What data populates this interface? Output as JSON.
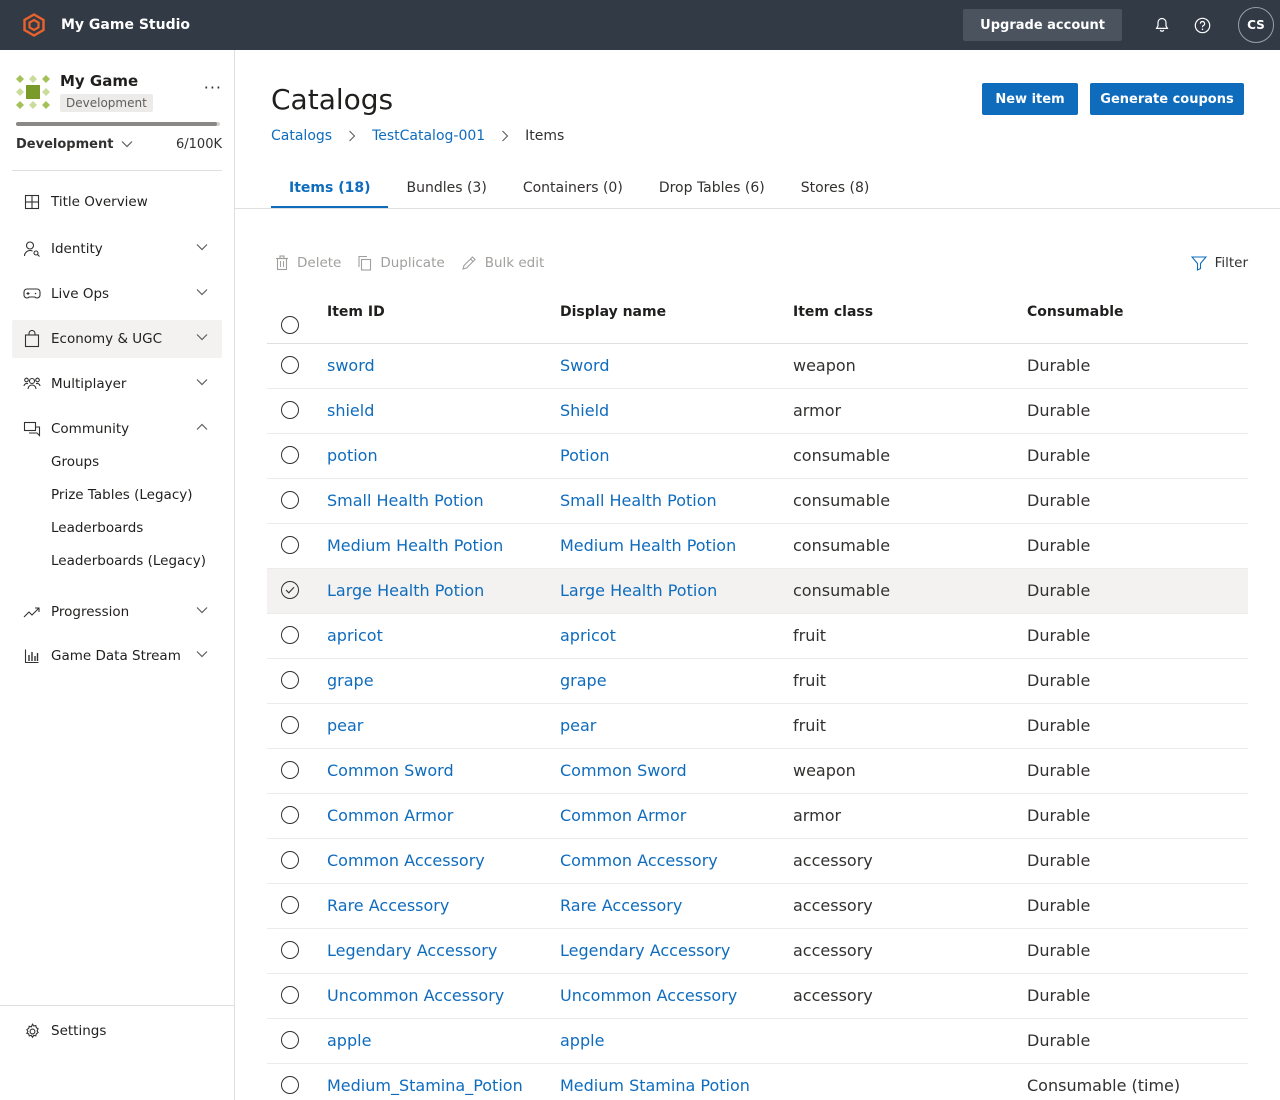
{
  "topbar": {
    "studio_name": "My Game Studio",
    "upgrade_label": "Upgrade account",
    "avatar_initials": "CS",
    "brand_color": "#e8622c"
  },
  "sidebar": {
    "game_name": "My Game",
    "game_env_badge": "Development",
    "more_label": "···",
    "environment": "Development",
    "quota": "6/100K",
    "quota_fraction": 6e-05,
    "nav": [
      {
        "label": "Title Overview",
        "icon": "grid-icon"
      },
      {
        "label": "Identity",
        "icon": "identity-icon"
      },
      {
        "label": "Live Ops",
        "icon": "gamepad-icon"
      },
      {
        "label": "Economy & UGC",
        "icon": "bag-icon"
      },
      {
        "label": "Multiplayer",
        "icon": "people-icon"
      },
      {
        "label": "Community",
        "icon": "chat-icon"
      },
      {
        "label": "Progression",
        "icon": "trend-icon"
      },
      {
        "label": "Game Data Stream",
        "icon": "bar-chart-icon"
      }
    ],
    "community_sub": [
      "Groups",
      "Prize Tables (Legacy)",
      "Leaderboards",
      "Leaderboards (Legacy)"
    ],
    "settings_label": "Settings"
  },
  "main": {
    "title": "Catalogs",
    "new_item_label": "New item",
    "generate_coupons_label": "Generate coupons",
    "breadcrumb": [
      "Catalogs",
      "TestCatalog-001",
      "Items"
    ],
    "tabs": [
      "Items (18)",
      "Bundles (3)",
      "Containers (0)",
      "Drop Tables (6)",
      "Stores (8)"
    ],
    "toolbar": {
      "delete": "Delete",
      "duplicate": "Duplicate",
      "bulk_edit": "Bulk edit",
      "filter": "Filter"
    },
    "columns": [
      "Item ID",
      "Display name",
      "Item class",
      "Consumable"
    ],
    "rows": [
      {
        "id": "sword",
        "name": "Sword",
        "class": "weapon",
        "consumable": "Durable"
      },
      {
        "id": "shield",
        "name": "Shield",
        "class": "armor",
        "consumable": "Durable"
      },
      {
        "id": "potion",
        "name": "Potion",
        "class": "consumable",
        "consumable": "Durable"
      },
      {
        "id": "Small Health Potion",
        "name": "Small Health Potion",
        "class": "consumable",
        "consumable": "Durable"
      },
      {
        "id": "Medium Health Potion",
        "name": "Medium Health Potion",
        "class": "consumable",
        "consumable": "Durable"
      },
      {
        "id": "Large Health Potion",
        "name": "Large Health Potion",
        "class": "consumable",
        "consumable": "Durable"
      },
      {
        "id": "apricot",
        "name": "apricot",
        "class": "fruit",
        "consumable": "Durable"
      },
      {
        "id": "grape",
        "name": "grape",
        "class": "fruit",
        "consumable": "Durable"
      },
      {
        "id": "pear",
        "name": "pear",
        "class": "fruit",
        "consumable": "Durable"
      },
      {
        "id": "Common Sword",
        "name": "Common Sword",
        "class": "weapon",
        "consumable": "Durable"
      },
      {
        "id": "Common Armor",
        "name": "Common Armor",
        "class": "armor",
        "consumable": "Durable"
      },
      {
        "id": "Common Accessory",
        "name": "Common Accessory",
        "class": "accessory",
        "consumable": "Durable"
      },
      {
        "id": "Rare Accessory",
        "name": "Rare Accessory",
        "class": "accessory",
        "consumable": "Durable"
      },
      {
        "id": "Legendary Accessory",
        "name": "Legendary Accessory",
        "class": "accessory",
        "consumable": "Durable"
      },
      {
        "id": "Uncommon Accessory",
        "name": "Uncommon Accessory",
        "class": "accessory",
        "consumable": "Durable"
      },
      {
        "id": "apple",
        "name": "apple",
        "class": "",
        "consumable": "Durable"
      },
      {
        "id": "Medium_Stamina_Potion",
        "name": "Medium Stamina Potion",
        "class": "",
        "consumable": "Consumable (time)"
      }
    ],
    "hovered_row_index": 5,
    "accent_color": "#0f6cbd"
  }
}
